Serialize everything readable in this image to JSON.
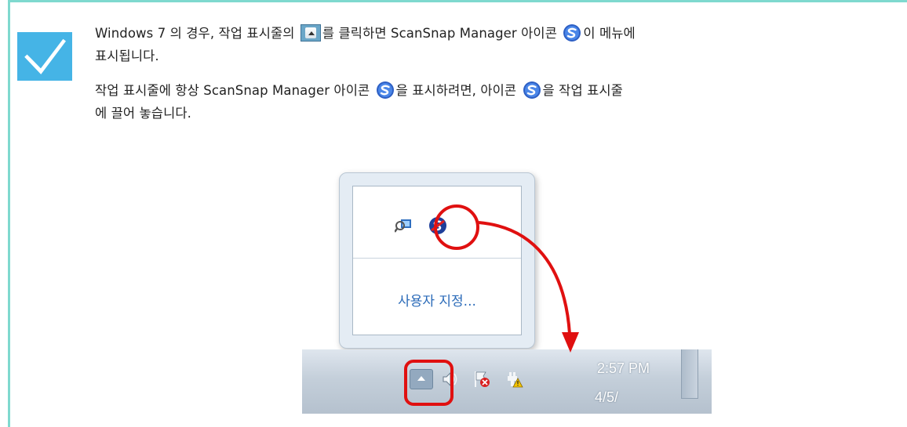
{
  "note": {
    "p1_before_button": "Windows 7 의 경우, 작업 표시줄의",
    "p1_after_button": "를 클릭하면 ScanSnap Manager 아이콘",
    "p1_after_icon": "이 메뉴에",
    "p1_line2": "표시됩니다.",
    "p2_before_icon": "작업 표시줄에 항상 ScanSnap Manager 아이콘",
    "p2_middle": "을 표시하려면, 아이콘",
    "p2_after_icon": "을 작업 표시줄",
    "p2_line2": "에 끌어 놓습니다."
  },
  "icons": {
    "checkmark": "checkmark-icon",
    "taskbar_up": "show-hidden-icons-button",
    "scansnap": "scansnap-manager-icon"
  },
  "screenshot": {
    "popup_customize": "사용자 지정...",
    "clock_time": "2:57 PM",
    "clock_date": "4/5/"
  },
  "colors": {
    "note_border": "#7fd9cf",
    "check_background": "#45b4e6",
    "highlight": "#e01010"
  }
}
